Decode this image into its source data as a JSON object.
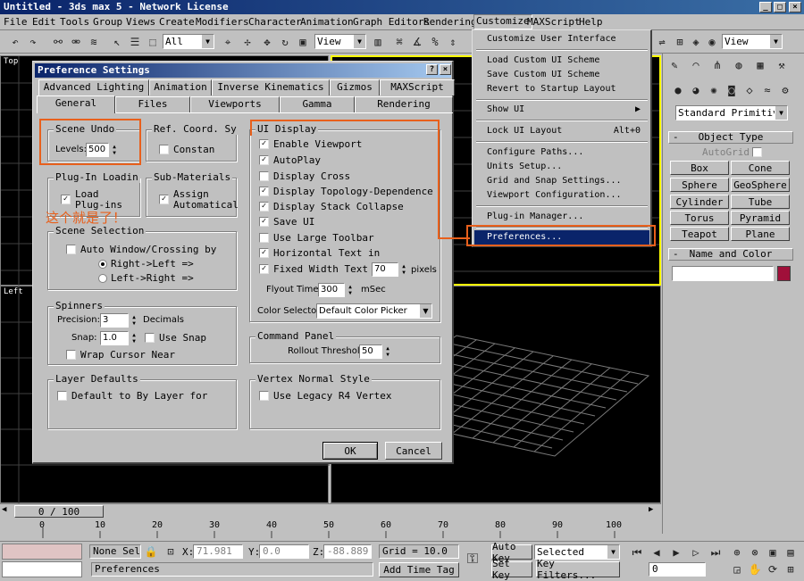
{
  "window": {
    "title": "Untitled - 3ds max 5 - Network License"
  },
  "menubar": [
    "File",
    "Edit",
    "Tools",
    "Group",
    "Views",
    "Create",
    "Modifiers",
    "Character",
    "Animation",
    "Graph Editors",
    "Rendering",
    "Customize",
    "MAXScript",
    "Help"
  ],
  "toolbar": {
    "selection_filter": "All",
    "ref_coord": "View",
    "ref_coord_right": "View"
  },
  "viewports": {
    "top_label": "Top",
    "left_label": "Left"
  },
  "dialog": {
    "title": "Preference Settings",
    "tabs_row1": [
      "Advanced Lighting",
      "Animation",
      "Inverse Kinematics",
      "Gizmos",
      "MAXScript"
    ],
    "tabs_row2": [
      "General",
      "Files",
      "Viewports",
      "Gamma",
      "Rendering"
    ],
    "scene_undo": {
      "title": "Scene Undo",
      "levels_label": "Levels:",
      "levels_value": "500"
    },
    "ref_coord": {
      "title": "Ref. Coord. Sy",
      "constant": "Constan"
    },
    "plugin": {
      "title": "Plug-In Loadin",
      "load": "Load Plug-ins"
    },
    "submaterials": {
      "title": "Sub-Materials",
      "assign": "Assign Automatical"
    },
    "annotation": "这个就是了！",
    "scene_selection": {
      "title": "Scene Selection",
      "auto_window": "Auto Window/Crossing by",
      "right_left": "Right->Left =>",
      "left_right": "Left->Right =>"
    },
    "spinners": {
      "title": "Spinners",
      "precision_label": "Precision:",
      "precision_value": "3",
      "decimals": "Decimals",
      "snap_label": "Snap:",
      "snap_value": "1.0",
      "use_snap": "Use Snap",
      "wrap": "Wrap Cursor Near"
    },
    "layer_defaults": {
      "title": "Layer Defaults",
      "default": "Default to By Layer for"
    },
    "ui_display": {
      "title": "UI Display",
      "items": [
        {
          "label": "Enable Viewport",
          "checked": true
        },
        {
          "label": "AutoPlay",
          "checked": true
        },
        {
          "label": "Display Cross",
          "checked": false
        },
        {
          "label": "Display Topology-Dependence",
          "checked": true
        },
        {
          "label": "Display Stack Collapse",
          "checked": true
        },
        {
          "label": "Save UI",
          "checked": true
        },
        {
          "label": "Use Large Toolbar",
          "checked": false
        },
        {
          "label": "Horizontal Text in",
          "checked": true
        },
        {
          "label": "Fixed Width Text",
          "checked": true
        }
      ],
      "fixed_width_value": "70",
      "pixels": "pixels",
      "flyout_label": "Flyout Time:",
      "flyout_value": "300",
      "msec": "mSec",
      "color_selector_label": "Color Selector:",
      "color_selector_value": "Default Color Picker"
    },
    "command_panel": {
      "title": "Command Panel",
      "rollout_label": "Rollout Threshold:",
      "rollout_value": "50"
    },
    "vertex_normal": {
      "title": "Vertex Normal Style",
      "legacy": "Use Legacy R4 Vertex"
    },
    "ok": "OK",
    "cancel": "Cancel"
  },
  "customize_menu": {
    "items": [
      {
        "label": "Customize User Interface",
        "shortcut": ""
      },
      {
        "sep": true
      },
      {
        "label": "Load Custom UI Scheme",
        "shortcut": ""
      },
      {
        "label": "Save Custom UI Scheme",
        "shortcut": ""
      },
      {
        "label": "Revert to Startup Layout",
        "shortcut": ""
      },
      {
        "sep": true
      },
      {
        "label": "Show UI",
        "shortcut": "▶"
      },
      {
        "sep": true
      },
      {
        "label": "Lock UI Layout",
        "shortcut": "Alt+0"
      },
      {
        "sep": true
      },
      {
        "label": "Configure Paths...",
        "shortcut": ""
      },
      {
        "label": "Units Setup...",
        "shortcut": ""
      },
      {
        "label": "Grid and Snap Settings...",
        "shortcut": ""
      },
      {
        "label": "Viewport Configuration...",
        "shortcut": ""
      },
      {
        "sep": true
      },
      {
        "label": "Plug-in Manager...",
        "shortcut": ""
      },
      {
        "sep": true
      },
      {
        "label": "Preferences...",
        "shortcut": "",
        "highlight": true
      }
    ]
  },
  "command_panel": {
    "category": "Standard Primitiv",
    "object_type_title": "Object Type",
    "autogrid": "AutoGrid",
    "buttons": [
      "Box",
      "Cone",
      "Sphere",
      "GeoSphere",
      "Cylinder",
      "Tube",
      "Torus",
      "Pyramid",
      "Teapot",
      "Plane"
    ],
    "name_color_title": "Name and Color"
  },
  "timeline": {
    "frame_counter": "0 / 100",
    "ticks": [
      "0",
      "10",
      "20",
      "30",
      "40",
      "50",
      "60",
      "70",
      "80",
      "90",
      "100"
    ]
  },
  "status": {
    "selection": "None Sele",
    "x_label": "X:",
    "x_value": "71.981",
    "y_label": "Y:",
    "y_value": "0.0",
    "z_label": "Z:",
    "z_value": "-88.889",
    "grid": "Grid = 10.0",
    "add_time_tag": "Add Time Tag",
    "auto_key": "Auto Key",
    "selected": "Selected",
    "set_key": "Set Key",
    "key_filters": "Key Filters...",
    "frame_value": "0",
    "prompt": "Preferences"
  },
  "colors": {
    "highlight": "#0a246a",
    "annotation": "#e8601c",
    "swatch": "#a0103a"
  }
}
